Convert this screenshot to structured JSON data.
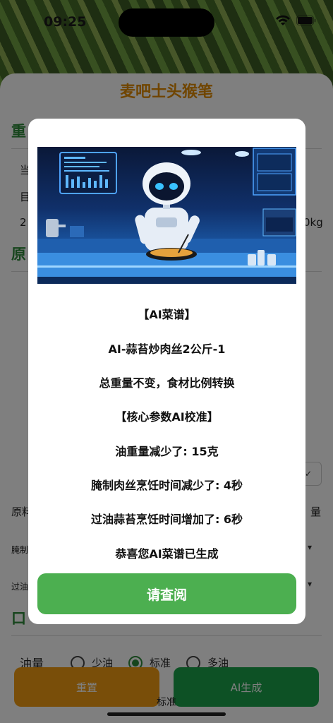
{
  "status_bar": {
    "time": "09:25"
  },
  "sheet": {
    "title": "麦吧士头猴笔",
    "section_weight": "重",
    "row1": "当",
    "row2": "目",
    "row3_prefix": "2",
    "row3_suffix": "0kg",
    "section_materials": "原",
    "materials_label": "原料",
    "materials_right": "量",
    "marinate_label": "腌制",
    "fry_label": "过油",
    "section_taste": "口"
  },
  "oil": {
    "label": "油量",
    "options": [
      "少油",
      "标准",
      "多油"
    ],
    "selected": "标准",
    "partial_under": "标准"
  },
  "bottom_buttons": {
    "reset": "重置",
    "ai": "AI生成"
  },
  "modal": {
    "lines": [
      "【AI菜谱】",
      "AI-蒜苔炒肉丝2公斤-1",
      "总重量不变，食材比例转换",
      "【核心参数AI校准】",
      "油重量减少了: 15克",
      "腌制肉丝烹饪时间减少了: 4秒",
      "过油蒜苔烹饪时间增加了: 6秒",
      "恭喜您AI菜谱已生成"
    ],
    "confirm_label": "请查阅"
  },
  "colors": {
    "accent_green": "#4caf50",
    "section_green": "#2e8b3a",
    "title_orange": "#e08a00",
    "reset_orange": "#f39c12",
    "ai_green": "#1aa34a"
  },
  "icons": [
    "wifi-icon",
    "battery-icon",
    "robot-chef-illustration",
    "chevron-down-icon"
  ]
}
